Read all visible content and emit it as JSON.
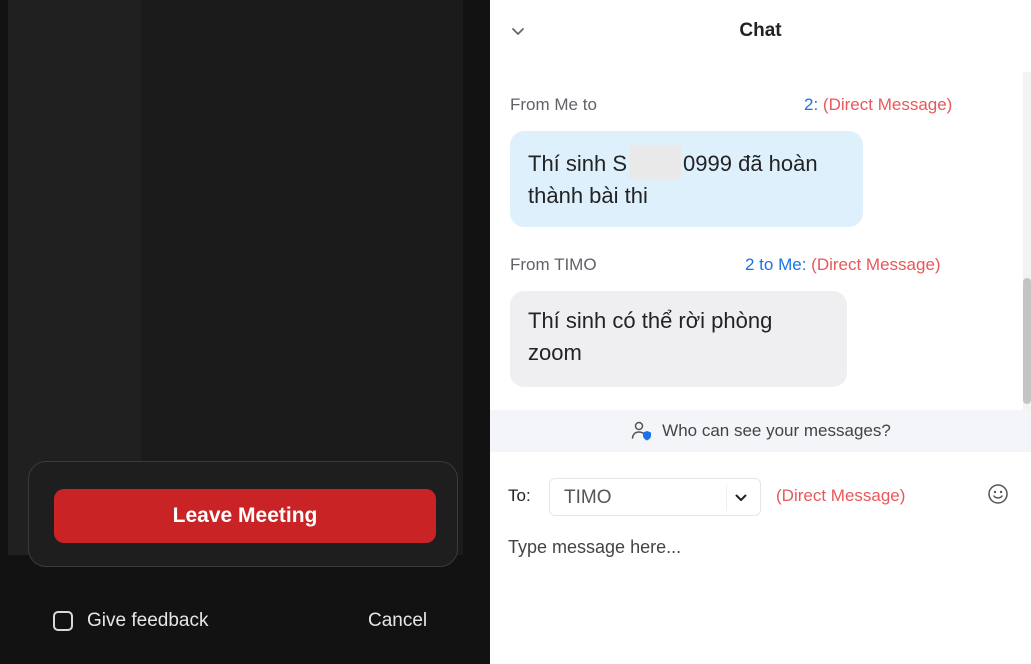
{
  "meeting": {
    "leave_button_label": "Leave Meeting",
    "feedback_label": "Give feedback",
    "cancel_label": "Cancel"
  },
  "chat": {
    "title": "Chat",
    "messages": [
      {
        "meta_left": "From Me to",
        "meta_blue": "2:",
        "meta_dm": "(Direct Message)",
        "text_before": "Thí sinh S",
        "text_after": "0999 đã hoàn thành bài thi"
      },
      {
        "meta_left": "From  TIMO",
        "meta_blue": "2 to Me:",
        "meta_dm": "(Direct Message)",
        "text": "Thí sinh có thể rời phòng zoom"
      }
    ],
    "privacy_text": "Who can see your messages?",
    "compose": {
      "to_label": "To:",
      "to_value": "TIMO",
      "dm_label": "(Direct Message)",
      "placeholder": "Type message here..."
    }
  },
  "colors": {
    "leave_red": "#c92326",
    "direct_message_red": "#e8585b",
    "my_bubble": "#dff0fd",
    "their_bubble": "#efeff2"
  },
  "icons": [
    "chevron-down-icon",
    "people-lock-icon",
    "dropdown-caret-icon",
    "emoji-icon"
  ]
}
